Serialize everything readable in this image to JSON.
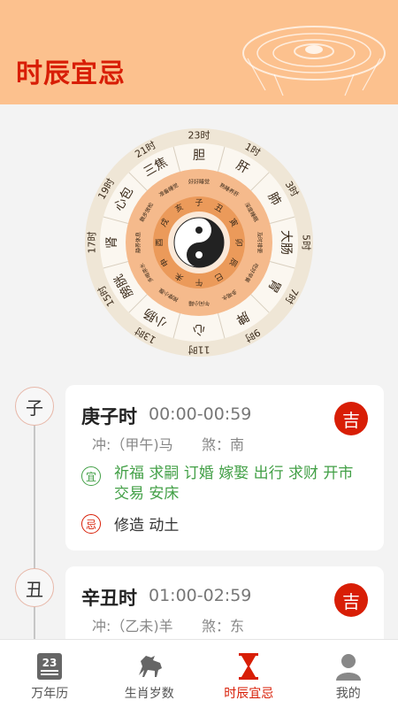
{
  "header": {
    "title": "时辰宜忌"
  },
  "wheel": {
    "hours": [
      "23时",
      "1时",
      "3时",
      "5时",
      "7时",
      "9时",
      "11时",
      "13时",
      "15时",
      "17时",
      "19时",
      "21时"
    ],
    "organs": [
      "胆",
      "肝",
      "肺",
      "大肠",
      "胃",
      "脾",
      "心",
      "小肠",
      "膀胱",
      "肾",
      "心包",
      "三焦"
    ],
    "branches": [
      "子",
      "丑",
      "寅",
      "卯",
      "辰",
      "巳",
      "午",
      "未",
      "申",
      "酉",
      "戌",
      "亥"
    ],
    "advice": [
      "好好睡觉",
      "熟睡养肝",
      "深度睡眠",
      "及时排便",
      "吃好早餐",
      "多喝水",
      "午间小睡",
      "按摩小腹",
      "多喝茶水",
      "静养休息",
      "散步放松",
      "准备睡觉"
    ]
  },
  "cards": [
    {
      "node": "子",
      "title": "庚子时",
      "time": "00:00-00:59",
      "chong": "冲:（甲午)马",
      "sha": "煞：南",
      "badge": "吉",
      "yi_label": "宜",
      "yi": "祈福 求嗣 订婚 嫁娶 出行 求财 开市 交易 安床",
      "ji_label": "忌",
      "ji": "修造 动土"
    },
    {
      "node": "丑",
      "title": "辛丑时",
      "time": "01:00-02:59",
      "chong": "冲:（乙未)羊",
      "sha": "煞：东",
      "badge": "吉"
    }
  ],
  "tabs": [
    {
      "label": "万年历",
      "icon": "calendar-icon",
      "calendar_day": "23"
    },
    {
      "label": "生肖岁数",
      "icon": "horse-icon"
    },
    {
      "label": "时辰宜忌",
      "icon": "hourglass-icon",
      "active": true
    },
    {
      "label": "我的",
      "icon": "user-icon"
    }
  ],
  "colors": {
    "accent": "#d81e06",
    "header_bg": "#fcc18e",
    "good": "#43a047"
  }
}
